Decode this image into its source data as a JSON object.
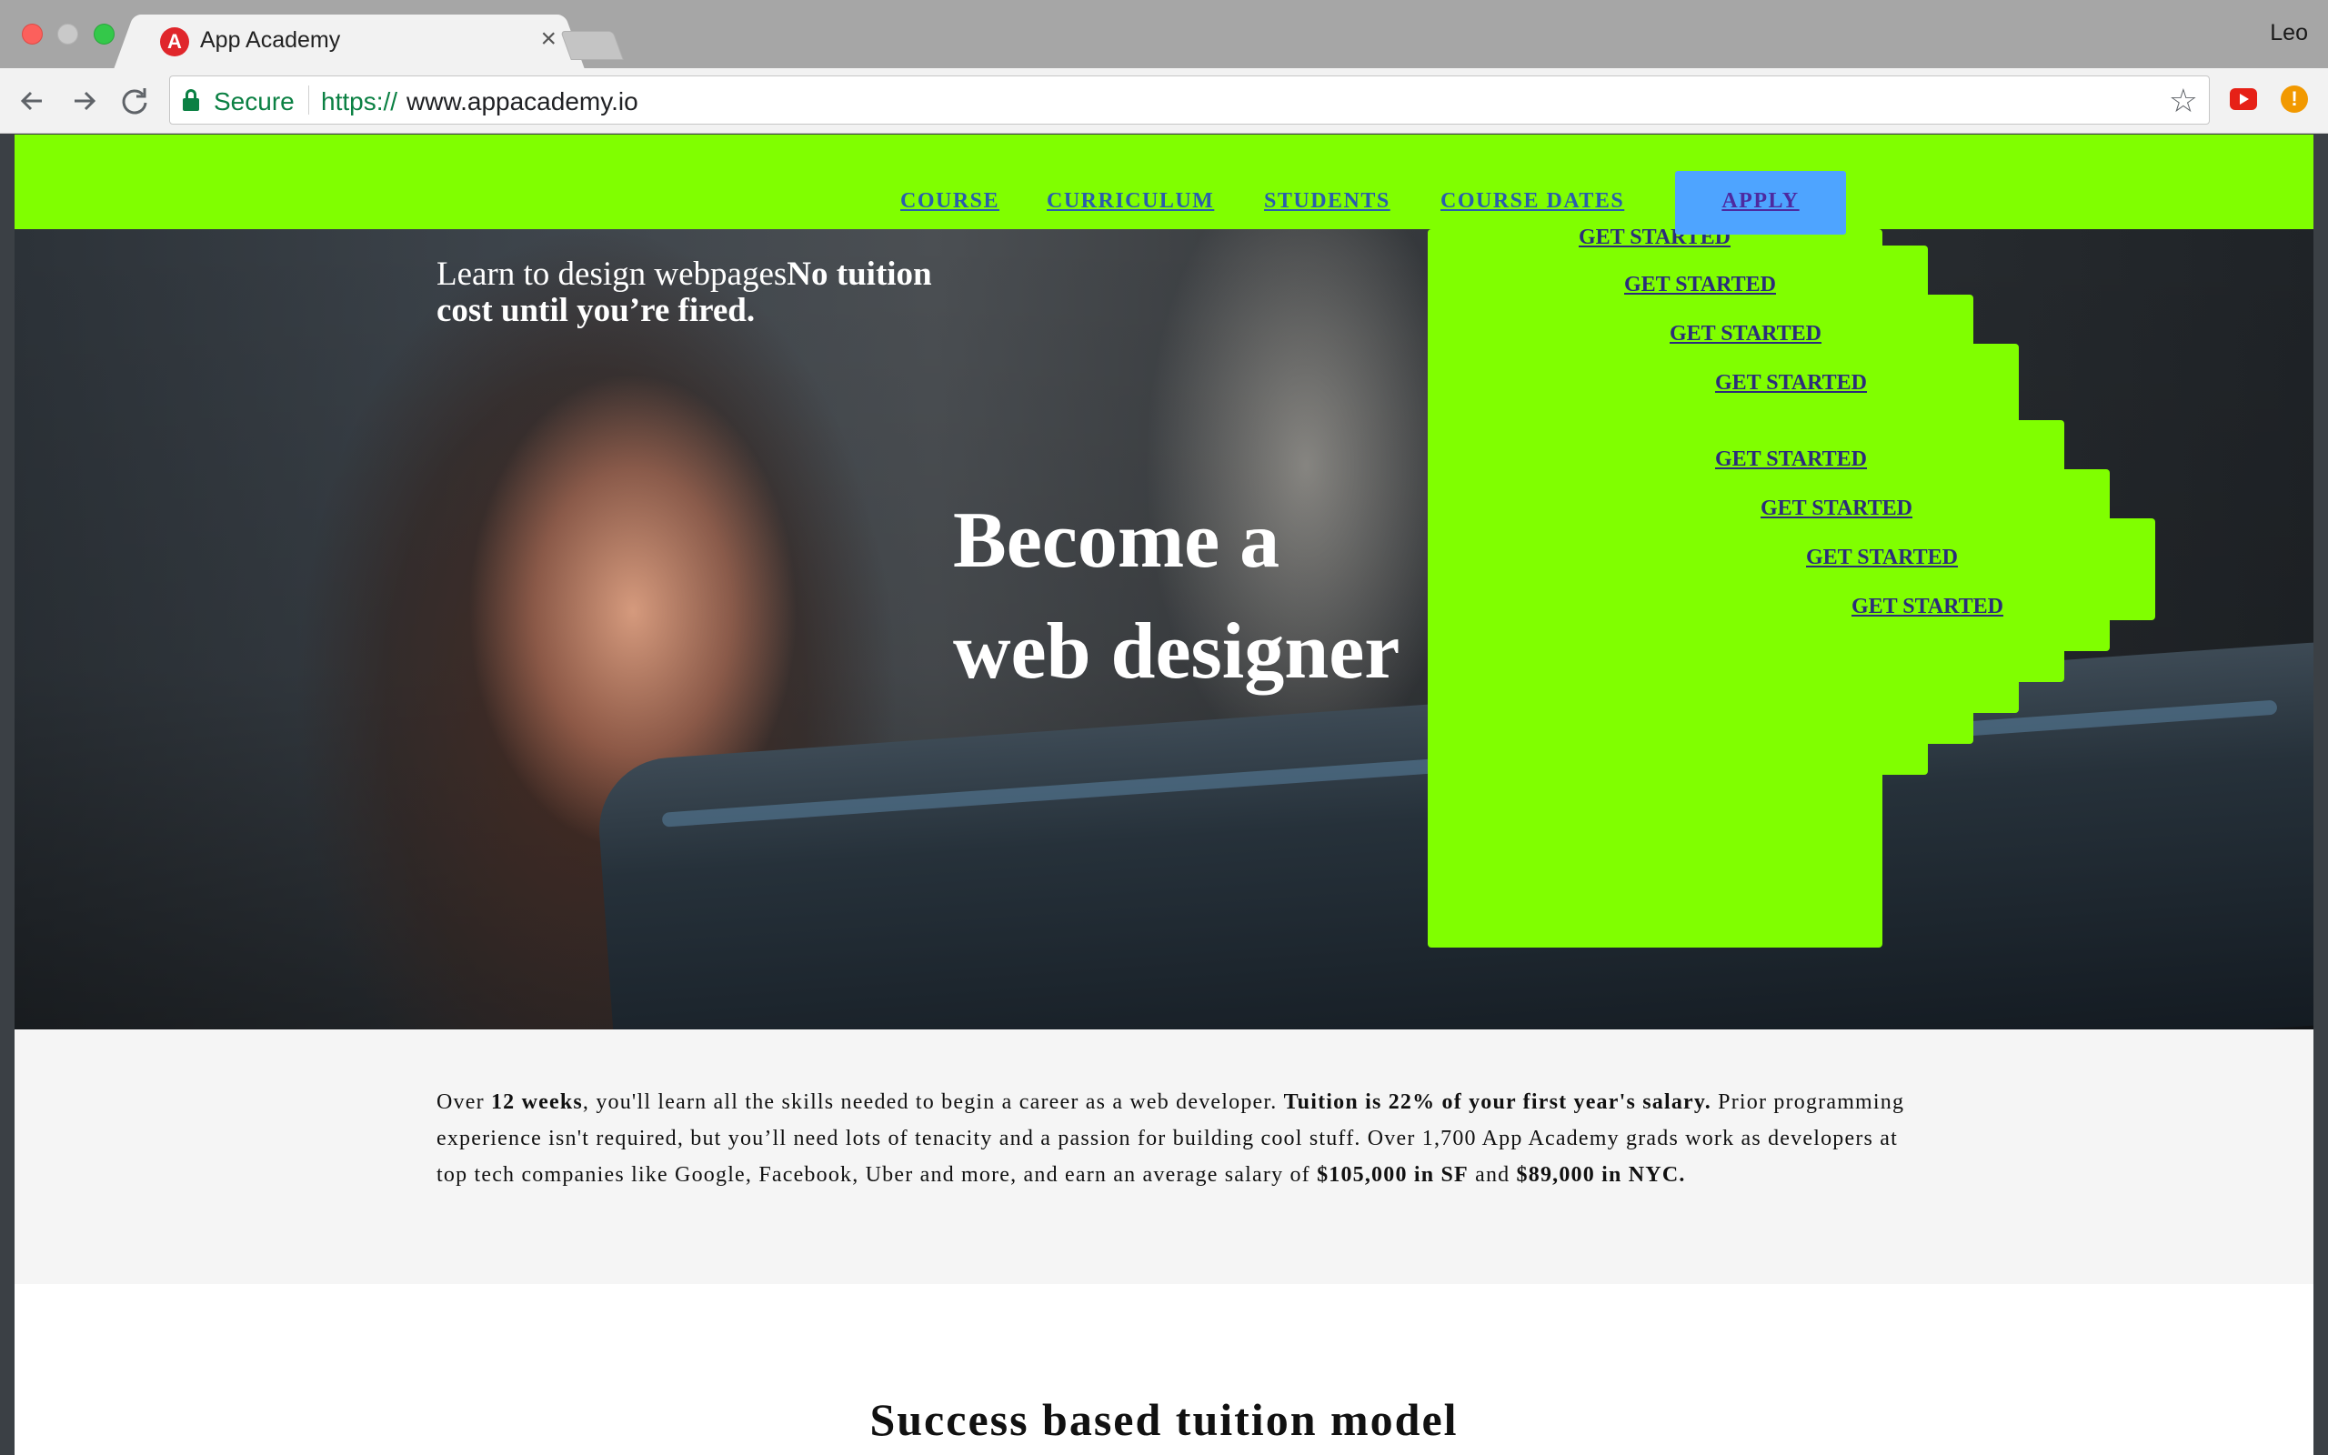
{
  "browser": {
    "tab_title": "App Academy",
    "tab_favicon": "A",
    "tab_close": "×",
    "profile_name": "Leo",
    "secure_label": "Secure",
    "url_scheme": "https://",
    "url_host": "www.appacademy.io",
    "icons": {
      "back": "back-arrow-icon",
      "forward": "forward-arrow-icon",
      "reload": "reload-icon",
      "lock": "lock-icon",
      "star": "star-icon",
      "youtube_ext": "youtube-icon",
      "alert_ext": "alert-icon"
    }
  },
  "nav": {
    "links": [
      "COURSE",
      "CURRICULUM",
      "STUDENTS",
      "COURSE DATES"
    ],
    "apply": "APPLY",
    "color": "#80ff00",
    "apply_color": "#4ea4ff"
  },
  "hero": {
    "tagline_regular": "Learn to design webpages",
    "tagline_bold": "No tuition cost until you’re fired.",
    "headline_line1": "Become a",
    "headline_line2": "web designer",
    "cta_links": [
      "GET STARTED",
      "GET STARTED",
      "GET STARTED",
      "GET STARTED",
      "GET STARTED",
      "GET STARTED",
      "GET STARTED",
      "GET STARTED"
    ]
  },
  "intro": {
    "p1": "Over ",
    "b1": "12 weeks",
    "p2": ", you'll learn all the skills needed to begin a career as a web developer. ",
    "b2": "Tuition is 22% of your first year's salary.",
    "p3": " Prior programming experience isn't required, but you’ll need lots of tenacity and a passion for building cool stuff. Over 1,700 App Academy grads work as developers at top tech companies like Google, Facebook, Uber and more, and earn an average salary of ",
    "b3": "$105,000 in SF",
    "p4": " and ",
    "b4": "$89,000 in NYC."
  },
  "section": {
    "title": "Success based tuition model"
  }
}
